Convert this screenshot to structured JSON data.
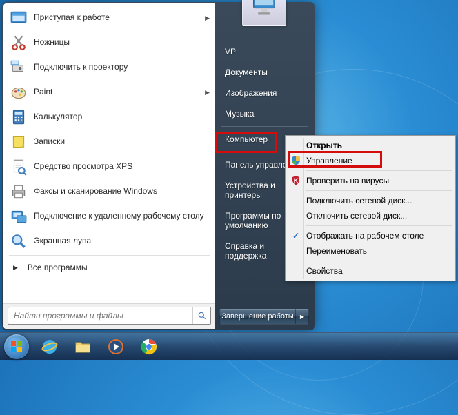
{
  "start": {
    "programs": [
      {
        "label": "Приступая к работе",
        "has_submenu": true,
        "icon": "getting-started"
      },
      {
        "label": "Ножницы",
        "has_submenu": false,
        "icon": "snip"
      },
      {
        "label": "Подключить к проектору",
        "has_submenu": false,
        "icon": "projector"
      },
      {
        "label": "Paint",
        "has_submenu": true,
        "icon": "paint"
      },
      {
        "label": "Калькулятор",
        "has_submenu": false,
        "icon": "calc"
      },
      {
        "label": "Записки",
        "has_submenu": false,
        "icon": "notes"
      },
      {
        "label": "Средство просмотра XPS",
        "has_submenu": false,
        "icon": "xps"
      },
      {
        "label": "Факсы и сканирование Windows",
        "has_submenu": false,
        "icon": "fax"
      },
      {
        "label": "Подключение к удаленному рабочему столу",
        "has_submenu": false,
        "icon": "remote"
      },
      {
        "label": "Экранная лупа",
        "has_submenu": false,
        "icon": "magnifier"
      }
    ],
    "all_programs": "Все программы",
    "search_placeholder": "Найти программы и файлы"
  },
  "right": {
    "user": "VP",
    "items_top": [
      "Документы",
      "Изображения",
      "Музыка"
    ],
    "computer": "Компьютер",
    "items_mid": [
      "Панель управления",
      "Устройства и принтеры",
      "Программы по умолчанию",
      "Справка и поддержка"
    ],
    "shutdown": "Завершение работы"
  },
  "context": {
    "open": "Открыть",
    "manage": "Управление",
    "virus": "Проверить на вирусы",
    "map": "Подключить сетевой диск...",
    "unmap": "Отключить сетевой диск...",
    "desktop": "Отображать на рабочем столе",
    "rename": "Переименовать",
    "props": "Свойства"
  },
  "taskbar": {
    "icons": [
      "start",
      "ie",
      "explorer",
      "media",
      "chrome"
    ]
  }
}
